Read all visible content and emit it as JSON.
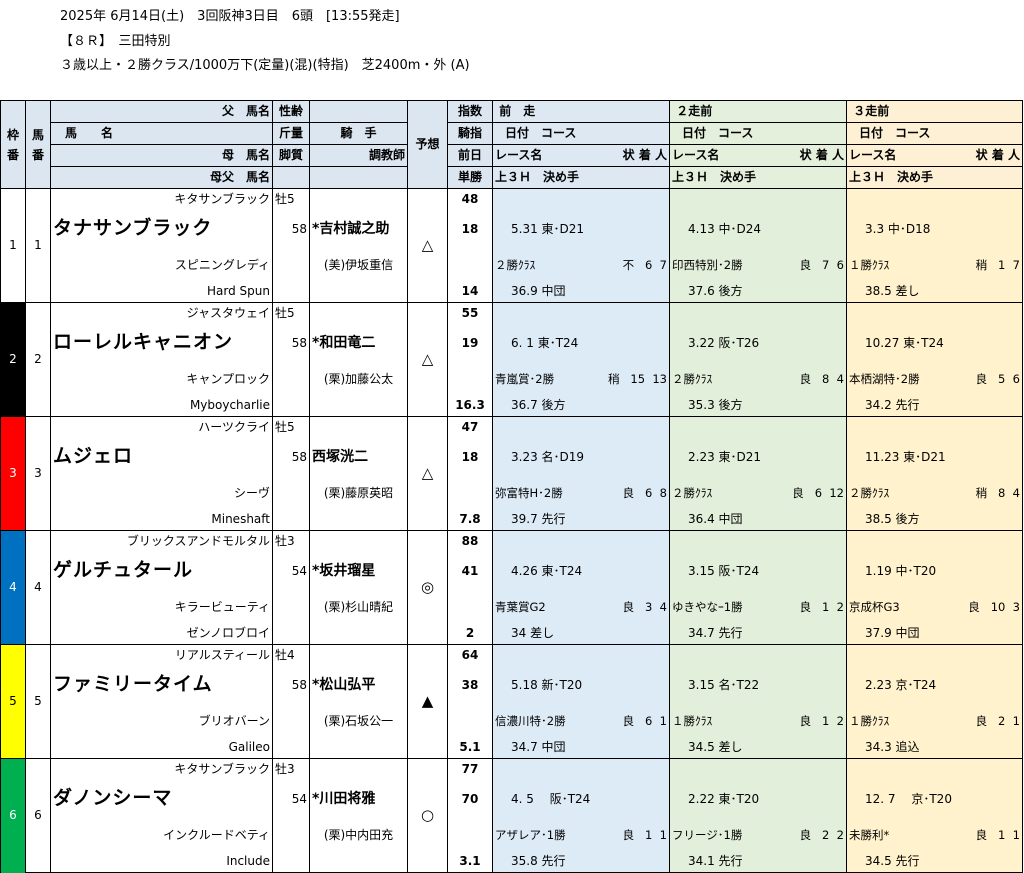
{
  "race": {
    "line1": "2025年 6月14日(土)　3回阪神3日目　6頭　[13:55発走]",
    "line2": "【８Ｒ】　三田特別",
    "line3": "３歳以上・２勝クラス/1000万下(定量)(混)(特指)　芝2400m・外 (A)"
  },
  "headers": {
    "waku": "枠番",
    "uma": "馬番",
    "father": "父　馬名",
    "horse_name": "馬　　名",
    "mother": "母　馬名",
    "mother_father": "母父　馬名",
    "sex_age": "性齢",
    "weight": "斤量",
    "leg": "脚質",
    "jockey": "騎　手",
    "trainer": "調教師",
    "yoso": "予想",
    "index": "指数",
    "jockey_index": "騎指",
    "prev_day": "前日",
    "win_odds": "単勝",
    "prev1": "前　走",
    "prev2": "２走前",
    "prev3": "３走前",
    "date_course": "日付　コース",
    "race_name": "レース名",
    "cond_place_num": "状 着 人",
    "last3f": "上３Ｈ　決め手"
  },
  "colors": {
    "waku1": "#ffffff",
    "waku2": "#000000",
    "waku3": "#ff0000",
    "waku4": "#0070c0",
    "waku5": "#ffff00",
    "waku6": "#00b050",
    "prev1_bg": "#ddebf7",
    "prev2_bg": "#e2efda",
    "prev3_bg": "#fff2cc"
  },
  "horses": [
    {
      "waku": "1",
      "uma": "1",
      "waku_color": "#ffffff",
      "waku_text": "#000000",
      "father": "キタサンブラック",
      "name": "タナサンブラック",
      "mother": "スピニングレディ",
      "mother_father": "Hard Spun",
      "sex_age": "牡5",
      "weight": "58",
      "jockey": "*吉村誠之助",
      "trainer": "(美)伊坂重信",
      "mark": "△",
      "index": "48",
      "jockey_index": "18",
      "odds": "14",
      "p1": {
        "date_course": "5.31 東･D21",
        "race": "２勝ｸﾗｽ",
        "cond": "不",
        "place": "6",
        "pop": "7",
        "l3f": "36.9 中団"
      },
      "p2": {
        "date_course": "4.13 中･D24",
        "race": "印西特別･2勝",
        "cond": "良",
        "place": "7",
        "pop": "6",
        "l3f": "37.6 後方"
      },
      "p3": {
        "date_course": "3.3 中･D18",
        "race": "１勝ｸﾗｽ",
        "cond": "稍",
        "place": "1",
        "pop": "7",
        "l3f": "38.5 差し"
      }
    },
    {
      "waku": "2",
      "uma": "2",
      "waku_color": "#000000",
      "waku_text": "#ffffff",
      "father": "ジャスタウェイ",
      "name": "ローレルキャニオン",
      "mother": "キャンプロック",
      "mother_father": "Myboycharlie",
      "sex_age": "牡5",
      "weight": "58",
      "jockey": "*和田竜二",
      "trainer": "(栗)加藤公太",
      "mark": "△",
      "index": "55",
      "jockey_index": "19",
      "odds": "16.3",
      "p1": {
        "date_course": "6. 1 東･T24",
        "race": "青嵐賞･2勝",
        "cond": "稍",
        "place": "15",
        "pop": "13",
        "l3f": "36.7 後方"
      },
      "p2": {
        "date_course": "3.22 阪･T26",
        "race": "２勝ｸﾗｽ",
        "cond": "良",
        "place": "8",
        "pop": "4",
        "l3f": "35.3 後方"
      },
      "p3": {
        "date_course": "10.27 東･T24",
        "race": "本栖湖特･2勝",
        "cond": "良",
        "place": "5",
        "pop": "6",
        "l3f": "34.2 先行"
      }
    },
    {
      "waku": "3",
      "uma": "3",
      "waku_color": "#ff0000",
      "waku_text": "#ffffff",
      "father": "ハーツクライ",
      "name": "ムジェロ",
      "mother": "シーヴ",
      "mother_father": "Mineshaft",
      "sex_age": "牡5",
      "weight": "58",
      "jockey": "西塚洸二",
      "trainer": "(栗)藤原英昭",
      "mark": "△",
      "index": "47",
      "jockey_index": "18",
      "odds": "7.8",
      "p1": {
        "date_course": "3.23 名･D19",
        "race": "弥富特H･2勝",
        "cond": "良",
        "place": "6",
        "pop": "8",
        "l3f": "39.7 先行"
      },
      "p2": {
        "date_course": "2.23 東･D21",
        "race": "２勝ｸﾗｽ",
        "cond": "良",
        "place": "6",
        "pop": "12",
        "l3f": "36.4 中団"
      },
      "p3": {
        "date_course": "11.23 東･D21",
        "race": "２勝ｸﾗｽ",
        "cond": "稍",
        "place": "8",
        "pop": "4",
        "l3f": "38.5 後方"
      }
    },
    {
      "waku": "4",
      "uma": "4",
      "waku_color": "#0070c0",
      "waku_text": "#ffffff",
      "father": "ブリックスアンドモルタル",
      "name": "ゲルチュタール",
      "mother": "キラービューティ",
      "mother_father": "ゼンノロブロイ",
      "sex_age": "牡3",
      "weight": "54",
      "jockey": "*坂井瑠星",
      "trainer": "(栗)杉山晴紀",
      "mark": "◎",
      "index": "88",
      "jockey_index": "41",
      "odds": "2",
      "p1": {
        "date_course": "4.26 東･T24",
        "race": "青葉賞G2",
        "cond": "良",
        "place": "3",
        "pop": "4",
        "l3f": "34 差し"
      },
      "p2": {
        "date_course": "3.15 阪･T24",
        "race": "ゆきやなｰ1勝",
        "cond": "良",
        "place": "1",
        "pop": "2",
        "l3f": "34.7 先行"
      },
      "p3": {
        "date_course": "1.19 中･T20",
        "race": "京成杯G3",
        "cond": "良",
        "place": "10",
        "pop": "3",
        "l3f": "37.9 中団"
      }
    },
    {
      "waku": "5",
      "uma": "5",
      "waku_color": "#ffff00",
      "waku_text": "#000000",
      "father": "リアルスティール",
      "name": "ファミリータイム",
      "mother": "ブリオバーン",
      "mother_father": "Galileo",
      "sex_age": "牡4",
      "weight": "58",
      "jockey": "*松山弘平",
      "trainer": "(栗)石坂公一",
      "mark": "▲",
      "index": "64",
      "jockey_index": "38",
      "odds": "5.1",
      "p1": {
        "date_course": "5.18 新･T20",
        "race": "信濃川特･2勝",
        "cond": "良",
        "place": "6",
        "pop": "1",
        "l3f": "34.7 中団"
      },
      "p2": {
        "date_course": "3.15 名･T22",
        "race": "１勝ｸﾗｽ",
        "cond": "良",
        "place": "1",
        "pop": "2",
        "l3f": "34.5 差し"
      },
      "p3": {
        "date_course": "2.23 京･T24",
        "race": "１勝ｸﾗｽ",
        "cond": "良",
        "place": "2",
        "pop": "1",
        "l3f": "34.3 追込"
      }
    },
    {
      "waku": "6",
      "uma": "6",
      "waku_color": "#00b050",
      "waku_text": "#ffffff",
      "father": "キタサンブラック",
      "name": "ダノンシーマ",
      "mother": "インクルードベティ",
      "mother_father": "Include",
      "sex_age": "牡3",
      "weight": "54",
      "jockey": "*川田将雅",
      "trainer": "(栗)中内田充",
      "mark": "○",
      "index": "77",
      "jockey_index": "70",
      "odds": "3.1",
      "p1": {
        "date_course": "4. 5　 阪･T24",
        "race": "アザレア･1勝",
        "cond": "良",
        "place": "1",
        "pop": "1",
        "l3f": "35.8 先行"
      },
      "p2": {
        "date_course": "2.22 東･T20",
        "race": "フリージ･1勝",
        "cond": "良",
        "place": "2",
        "pop": "2",
        "l3f": "34.1 先行"
      },
      "p3": {
        "date_course": "12. 7　 京･T20",
        "race": "未勝利*",
        "cond": "良",
        "place": "1",
        "pop": "1",
        "l3f": "34.5 先行"
      }
    }
  ]
}
